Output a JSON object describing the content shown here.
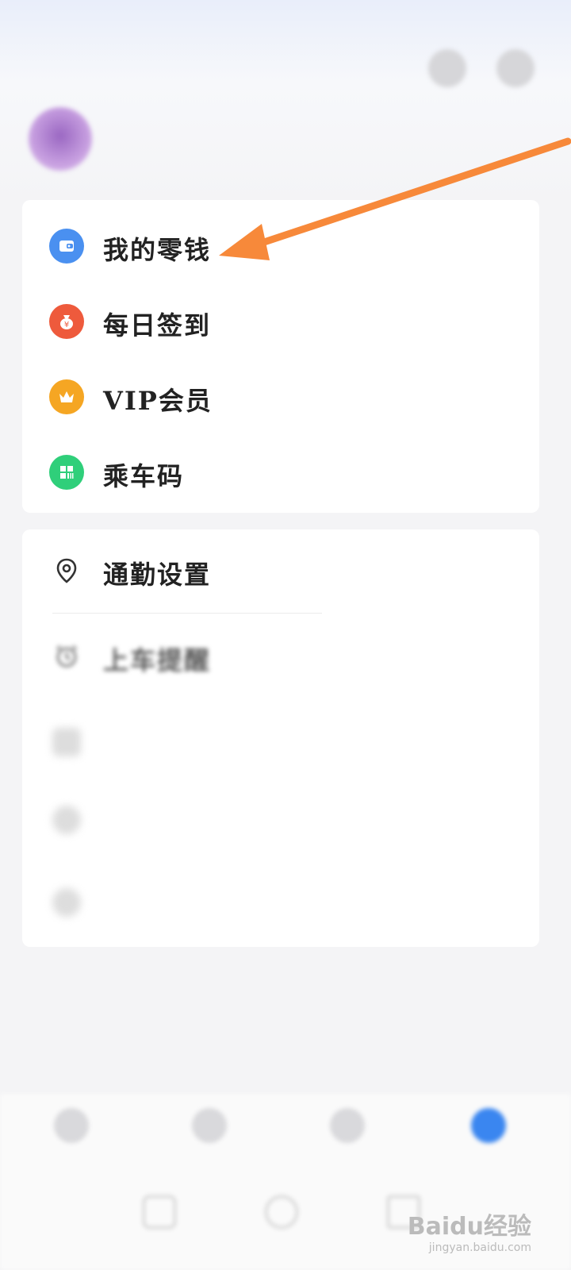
{
  "status_bar": {
    "time": "",
    "indicators": ""
  },
  "profile": {
    "phone": "",
    "link": ""
  },
  "wallet_card": {
    "items": [
      {
        "label": "我的零钱",
        "right": "",
        "icon": "wallet-icon",
        "color": "#4a90f0"
      },
      {
        "label": "每日签到",
        "right": "",
        "icon": "money-bag-icon",
        "color": "#ee5a3c"
      },
      {
        "label": "VIP会员",
        "right": "",
        "icon": "crown-icon",
        "color": "#f5a623"
      },
      {
        "label": "乘车码",
        "right": "",
        "icon": "qr-code-icon",
        "color": "#2fcf7a"
      }
    ]
  },
  "settings_card": {
    "items": [
      {
        "label": "通勤设置",
        "icon": "location-pin-icon"
      },
      {
        "label": "上车提醒",
        "icon": "alarm-clock-icon"
      },
      {
        "label": "",
        "icon": "thumb-icon"
      },
      {
        "label": "",
        "icon": "help-icon"
      },
      {
        "label": "",
        "icon": "info-icon"
      }
    ]
  },
  "bottom_nav": {
    "items": [
      {
        "label": "",
        "active": false
      },
      {
        "label": "",
        "active": false
      },
      {
        "label": "",
        "active": false
      },
      {
        "label": "",
        "active": true
      }
    ],
    "active_color": "#3a86f0"
  },
  "annotation": {
    "arrow_color": "#f7893a"
  },
  "watermark": {
    "logo": "Baidu经验",
    "url": "jingyan.baidu.com"
  }
}
